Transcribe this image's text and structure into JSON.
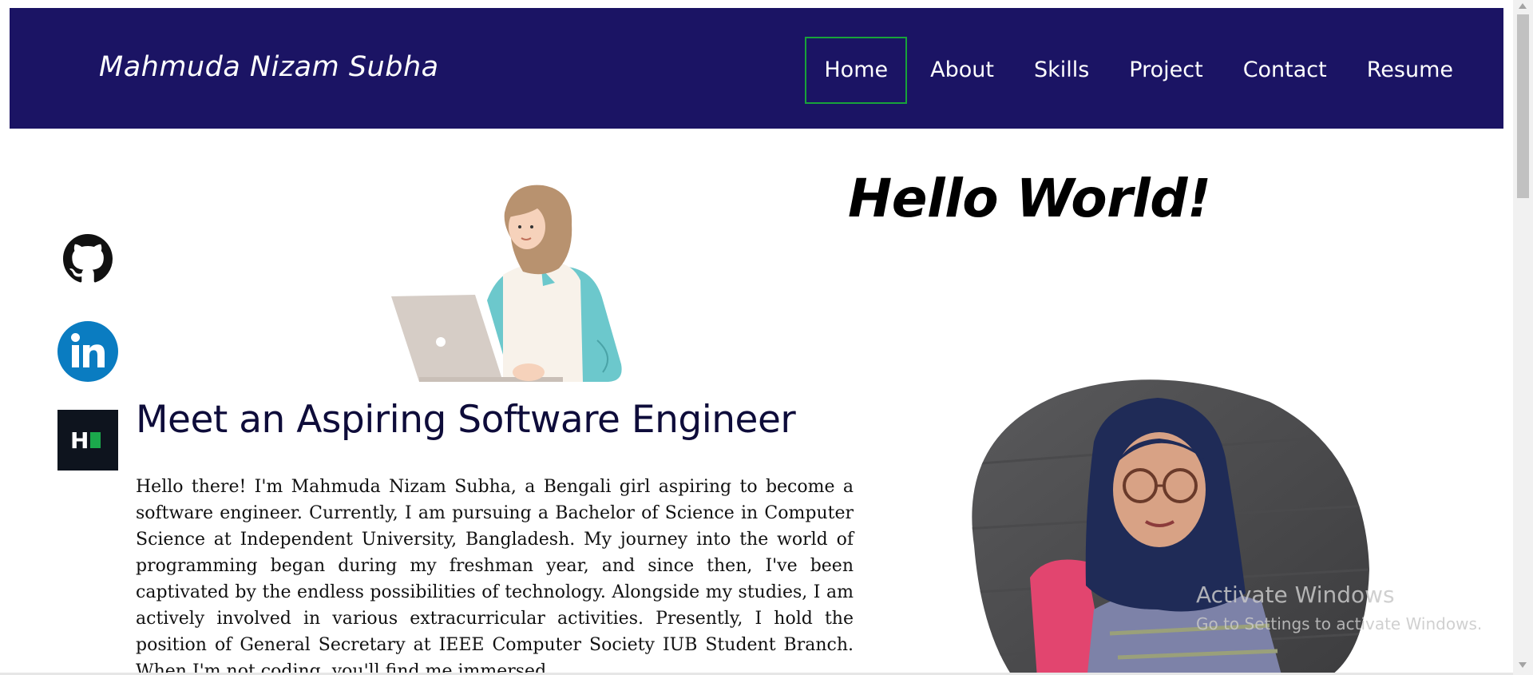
{
  "navbar": {
    "brand": "Mahmuda Nizam Subha",
    "links": [
      {
        "label": "Home",
        "active": true
      },
      {
        "label": "About",
        "active": false
      },
      {
        "label": "Skills",
        "active": false
      },
      {
        "label": "Project",
        "active": false
      },
      {
        "label": "Contact",
        "active": false
      },
      {
        "label": "Resume",
        "active": false
      }
    ],
    "background_color": "#1b1464",
    "active_border_color": "#18a33a"
  },
  "social": [
    {
      "name": "github",
      "icon": "github-icon"
    },
    {
      "name": "linkedin",
      "icon": "linkedin-icon"
    },
    {
      "name": "hackerrank",
      "icon": "hackerrank-icon",
      "glyph": "H"
    }
  ],
  "hero": {
    "greeting": "Hello World!",
    "heading": "Meet an Aspiring Software Engineer",
    "intro": "Hello there! I'm Mahmuda Nizam Subha, a Bengali girl aspiring to become a software engineer. Currently, I am pursuing a Bachelor of Science in Computer Science at Independent University, Bangladesh. My journey into the world of programming began during my freshman year, and since then, I've been captivated by the endless possibilities of technology. Alongside my studies, I am actively involved in various extracurricular activities. Presently, I hold the position of General Secretary at IEEE Computer Society IUB Student Branch. When I'm not coding, you'll find me immersed",
    "illustration": "girl-with-laptop-illustration",
    "photo": "profile-photo"
  },
  "watermark": {
    "title": "Activate Windows",
    "subtitle": "Go to Settings to activate Windows."
  }
}
